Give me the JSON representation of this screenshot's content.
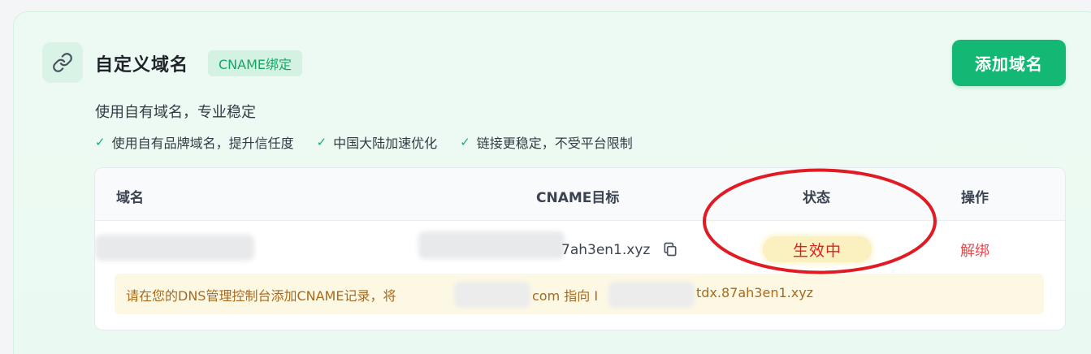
{
  "header": {
    "title": "自定义域名",
    "badge": "CNAME绑定",
    "add_button": "添加域名",
    "subtitle": "使用自有域名，专业稳定"
  },
  "features": [
    "使用自有品牌域名，提升信任度",
    "中国大陆加速优化",
    "链接更稳定，不受平台限制"
  ],
  "table": {
    "columns": [
      "域名",
      "CNAME目标",
      "状态",
      "操作"
    ],
    "rows": [
      {
        "domain": "",
        "cname_target_visible": "7ah3en1.xyz",
        "status": "生效中",
        "action": "解绑"
      }
    ]
  },
  "notice": {
    "prefix": "请在您的DNS管理控制台添加CNAME记录，将",
    "middle": "com 指向 I",
    "suffix": "tdx.87ah3en1.xyz"
  },
  "colors": {
    "accent": "#12b874",
    "annotation": "#e01b24",
    "danger": "#e5484d",
    "notice": "#a86a1c"
  },
  "icons": {
    "header": "link-icon",
    "feature": "check-icon",
    "copy": "copy-icon"
  }
}
